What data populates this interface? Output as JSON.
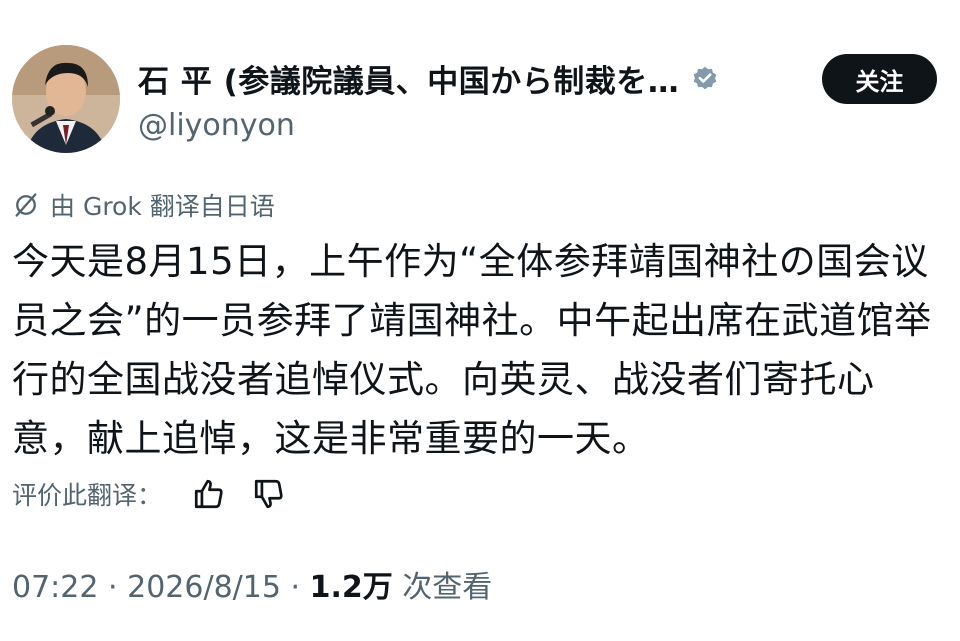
{
  "author": {
    "display_name": "石 平 (参議院議員、中国から制裁を…",
    "handle": "@liyonyon",
    "verified_icon": "verified-badge-icon"
  },
  "follow_label": "关注",
  "translation": {
    "icon": "grok-icon",
    "label": "由 Grok 翻译自日语"
  },
  "tweet": {
    "text": "今天是8月15日，上午作为“全体参拜靖国神社の国会议员之会”的一员参拜了靖国神社。中午起出席在武道馆举行的全国战没者追悼仪式。向英灵、战没者们寄托心意，献上追悼，这是非常重要的一天。"
  },
  "rating": {
    "label": "评价此翻译：",
    "thumbs_up_icon": "thumbs-up-icon",
    "thumbs_down_icon": "thumbs-down-icon"
  },
  "meta": {
    "time": "07:22",
    "date": "2026/8/15",
    "separator": "·",
    "views_count": "1.2万",
    "views_label": "次查看"
  },
  "colors": {
    "primary_text": "#0f1419",
    "secondary_text": "#536471",
    "button_bg": "#0f1419"
  }
}
